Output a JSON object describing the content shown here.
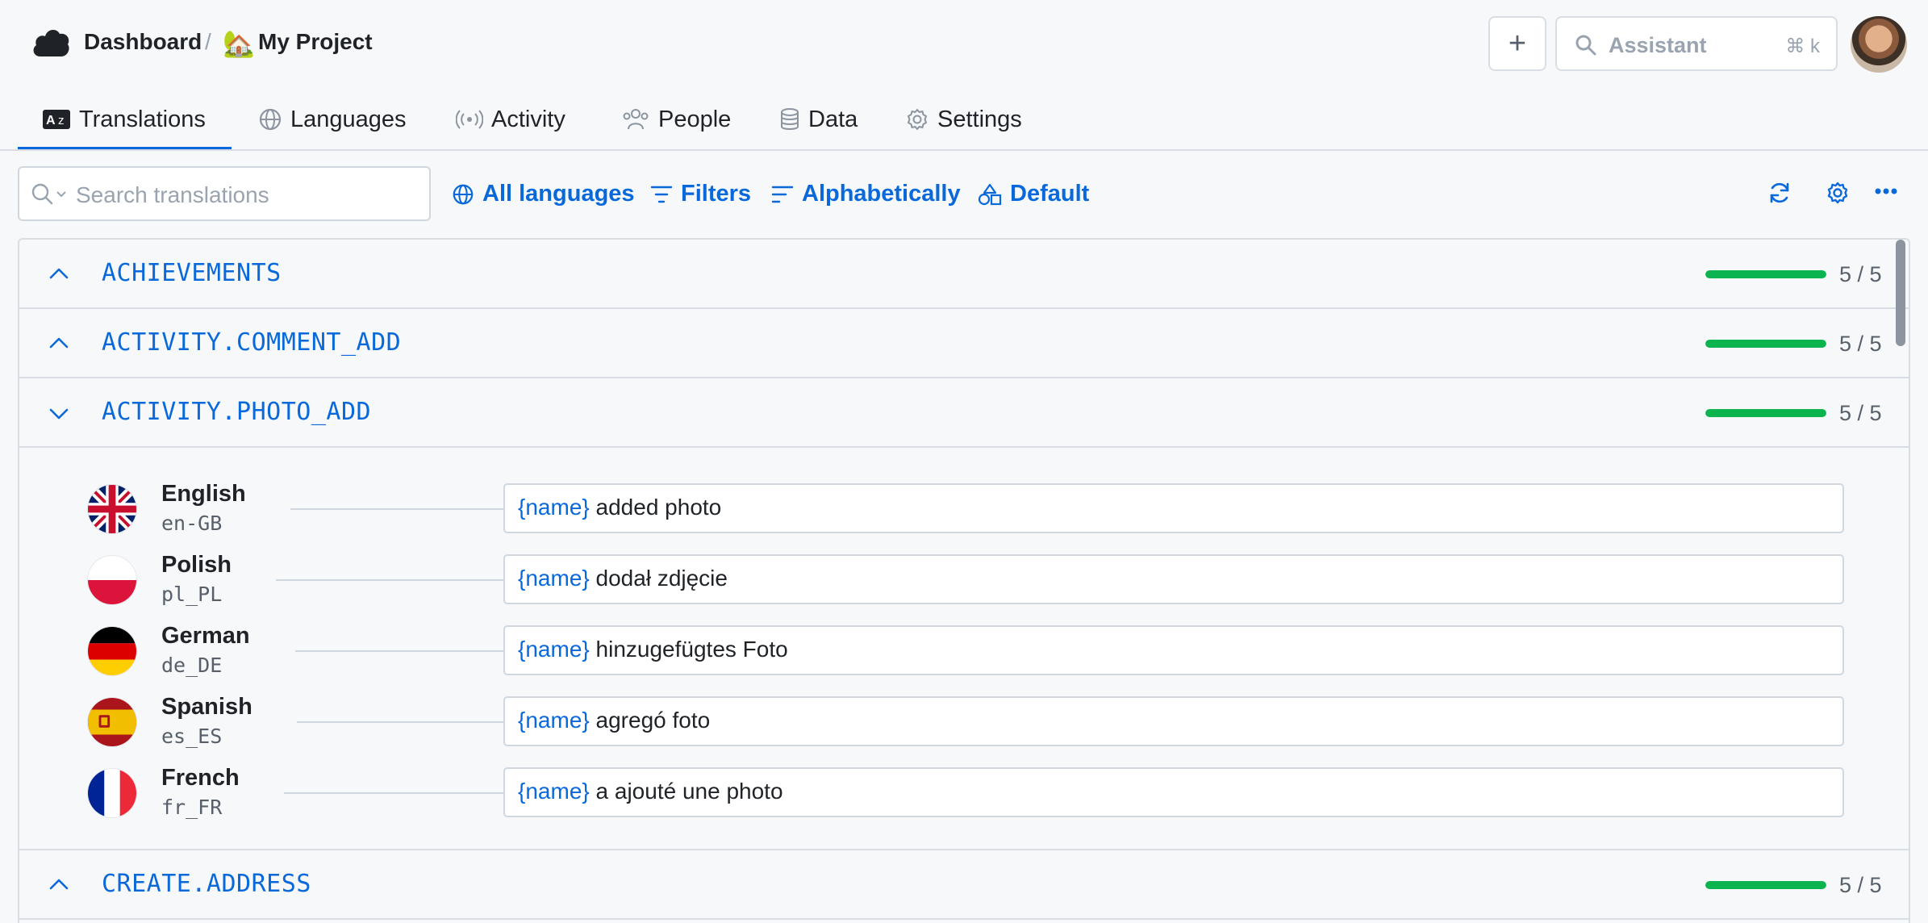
{
  "header": {
    "crumb_dashboard": "Dashboard",
    "crumb_sep": "/",
    "project_emoji": "🏡",
    "project_name": "My Project",
    "add_label": "+",
    "assistant_placeholder": "Assistant",
    "assistant_shortcut": "⌘ k"
  },
  "tabs": [
    {
      "label": "Translations",
      "icon": "translate-icon",
      "active": true
    },
    {
      "label": "Languages",
      "icon": "globe-icon"
    },
    {
      "label": "Activity",
      "icon": "broadcast-icon"
    },
    {
      "label": "People",
      "icon": "people-icon"
    },
    {
      "label": "Data",
      "icon": "database-icon"
    },
    {
      "label": "Settings",
      "icon": "gear-icon"
    }
  ],
  "toolbar": {
    "search_placeholder": "Search translations",
    "all_languages": "All languages",
    "filters": "Filters",
    "sort": "Alphabetically",
    "view": "Default"
  },
  "keys": [
    {
      "key": "ACHIEVEMENTS",
      "count": "5 / 5",
      "progress": 1.0,
      "expanded": false
    },
    {
      "key": "ACTIVITY.COMMENT_ADD",
      "count": "5 / 5",
      "progress": 1.0,
      "expanded": false
    },
    {
      "key": "ACTIVITY.PHOTO_ADD",
      "count": "5 / 5",
      "progress": 1.0,
      "expanded": true
    },
    {
      "key": "CREATE.ADDRESS",
      "count": "5 / 5",
      "progress": 1.0,
      "expanded": false
    }
  ],
  "translations": [
    {
      "language": "English",
      "code": "en-GB",
      "var": "{name}",
      "text": " added photo"
    },
    {
      "language": "Polish",
      "code": "pl_PL",
      "var": "{name}",
      "text": " dodał zdjęcie"
    },
    {
      "language": "German",
      "code": "de_DE",
      "var": "{name}",
      "text": " hinzugefügtes Foto"
    },
    {
      "language": "Spanish",
      "code": "es_ES",
      "var": "{name}",
      "text": " agregó foto"
    },
    {
      "language": "French",
      "code": "fr_FR",
      "var": "{name}",
      "text": " a ajouté une photo"
    }
  ],
  "colors": {
    "accent": "#0969da",
    "progress": "#0cb450",
    "border": "#d8dee4"
  }
}
